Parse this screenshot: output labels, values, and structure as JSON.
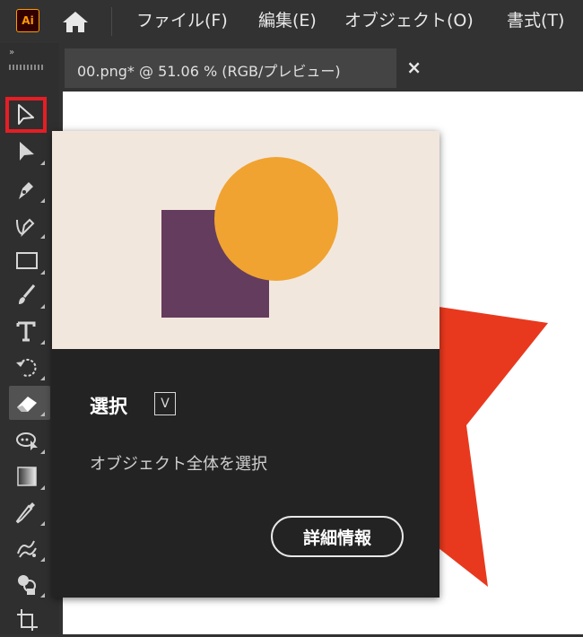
{
  "app": {
    "logo_text": "Ai",
    "accent_color": "#ff9a00"
  },
  "menu": {
    "items": [
      "ファイル(F)",
      "編集(E)",
      "オブジェクト(O)",
      "書式(T)"
    ]
  },
  "toolbar": {
    "collapse_label": "»",
    "tools": [
      {
        "name": "selection-tool",
        "icon": "hollow-arrow-icon",
        "highlighted": true
      },
      {
        "name": "direct-selection-tool",
        "icon": "solid-arrow-icon"
      },
      {
        "name": "pen-tool",
        "icon": "pen-nib-icon"
      },
      {
        "name": "curvature-tool",
        "icon": "curvature-pen-icon"
      },
      {
        "name": "rectangle-tool",
        "icon": "rectangle-icon"
      },
      {
        "name": "paintbrush-tool",
        "icon": "brush-icon"
      },
      {
        "name": "type-tool",
        "icon": "type-t-icon"
      },
      {
        "name": "rotate-tool",
        "icon": "rotate-icon"
      },
      {
        "name": "eraser-tool",
        "icon": "eraser-icon",
        "active": true
      },
      {
        "name": "puppet-warp-tool",
        "icon": "puppet-warp-icon"
      },
      {
        "name": "gradient-tool",
        "icon": "gradient-icon"
      },
      {
        "name": "eyedropper-tool",
        "icon": "eyedropper-icon"
      },
      {
        "name": "symbol-sprayer-tool",
        "icon": "symbol-sprayer-icon"
      },
      {
        "name": "shape-builder-tool",
        "icon": "shape-builder-icon"
      },
      {
        "name": "artboard-tool",
        "icon": "artboard-icon"
      }
    ],
    "highlight_color": "#e51e25"
  },
  "document": {
    "tab_title": "00.png* @ 51.06 % (RGB/プレビュー)",
    "close_label": "×"
  },
  "canvas": {
    "shape_color": "#e8391e"
  },
  "tooltip": {
    "title": "選択",
    "shortcut": "V",
    "description": "オブジェクト全体を選択",
    "learn_more_label": "詳細情報",
    "illustration": {
      "background": "#f2e7dd",
      "square_color": "#643c5e",
      "circle_color": "#f0a330"
    }
  }
}
